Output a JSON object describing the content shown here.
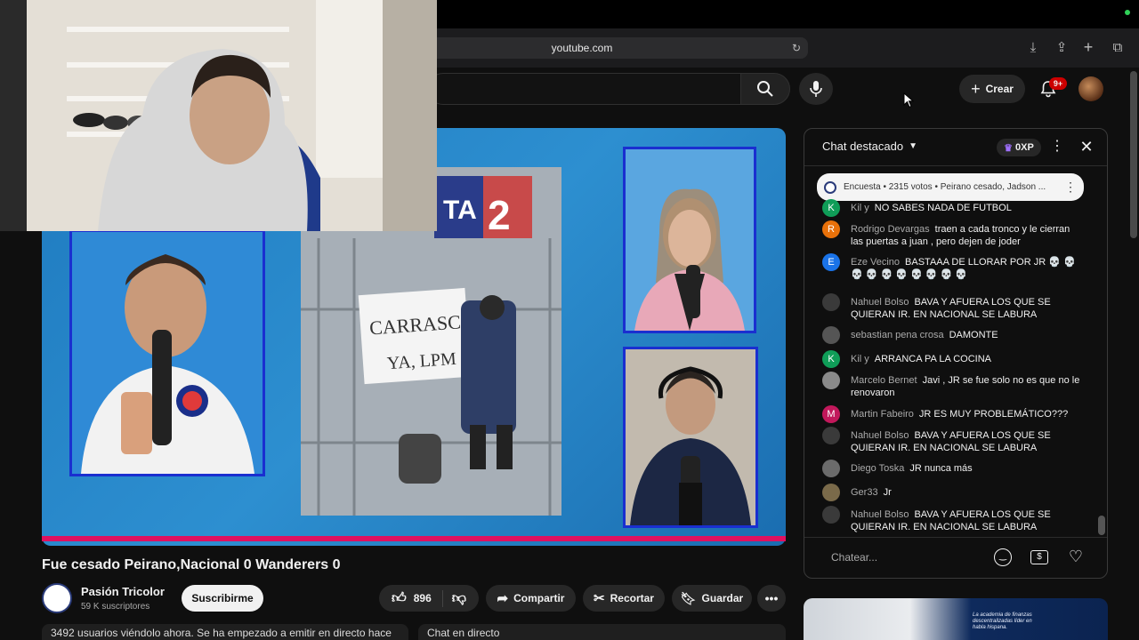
{
  "browser": {
    "url": "youtube.com"
  },
  "header": {
    "create_label": "Crear",
    "notification_count": "9+"
  },
  "video": {
    "scoreboard_text": "TA",
    "scoreboard_number": "2",
    "banner_text": "CARRASC\nYA, LPM",
    "banner_line1": "CARRASC",
    "banner_line2": "YA, LPM",
    "title": "Fue cesado Peirano,Nacional 0 Wanderers 0",
    "channel_name": "Pasión Tricolor",
    "subscribers": "59 K suscriptores",
    "subscribe_label": "Suscribirme",
    "likes": "896",
    "share_label": "Compartir",
    "clip_label": "Recortar",
    "save_label": "Guardar",
    "description_peek": "3492 usuarios viéndolo ahora. Se ha empezado a emitir en directo hace",
    "chat_replay_peek": "Chat en directo"
  },
  "chat": {
    "title": "Chat destacado",
    "xp_label": "0XP",
    "poll_text": "Encuesta • 2315 votos • Peirano cesado, Jadson ...",
    "input_placeholder": "Chatear...",
    "messages": [
      {
        "author": "Kil y",
        "text": "NO SABES NADA DE FUTBOL",
        "initial": "K",
        "color": "#0f9d58"
      },
      {
        "author": "Rodrigo Devargas",
        "text": "traen a cada tronco y le cierran las puertas a juan , pero dejen de joder",
        "initial": "R",
        "color": "#e8710a"
      },
      {
        "author": "Eze Vecino",
        "text": "BASTAAA DE LLORAR POR JR 💀 💀 💀 💀 💀 💀 💀 💀 💀 💀",
        "initial": "E",
        "color": "#1a73e8"
      },
      {
        "author": "Nahuel Bolso",
        "text": "BAVA Y AFUERA LOS QUE SE QUIERAN IR. EN NACIONAL SE LABURA",
        "initial": "",
        "color": "#3a3a3a"
      },
      {
        "author": "sebastian pena crosa",
        "text": "DAMONTE",
        "initial": "",
        "color": "#555555"
      },
      {
        "author": "Kil y",
        "text": "ARRANCA PA LA COCINA",
        "initial": "K",
        "color": "#0f9d58"
      },
      {
        "author": "Marcelo Bernet",
        "text": "Javi , JR se fue solo no es que no le renovaron",
        "initial": "",
        "color": "#8a8a8a"
      },
      {
        "author": "Martin Fabeiro",
        "text": "JR ES MUY PROBLEMÁTICO???",
        "initial": "M",
        "color": "#c2185b"
      },
      {
        "author": "Nahuel Bolso",
        "text": "BAVA Y AFUERA LOS QUE SE QUIERAN IR. EN NACIONAL SE LABURA",
        "initial": "",
        "color": "#3a3a3a"
      },
      {
        "author": "Diego Toska",
        "text": "JR nunca más",
        "initial": "",
        "color": "#6b6b6b"
      },
      {
        "author": "Ger33",
        "text": "Jr",
        "initial": "",
        "color": "#7a6a4a"
      },
      {
        "author": "Nahuel Bolso",
        "text": "BAVA Y AFUERA LOS QUE SE QUIERAN IR. EN NACIONAL SE LABURA",
        "initial": "",
        "color": "#3a3a3a"
      }
    ]
  },
  "ad": {
    "text": "La academia de finanzas descentralizadas líder en habla hispana."
  },
  "colors": {
    "accent_red": "#cc0000",
    "progress": "#e0115f",
    "video_blue": "#2d8fd0",
    "panel_border": "#1a2fd0"
  }
}
